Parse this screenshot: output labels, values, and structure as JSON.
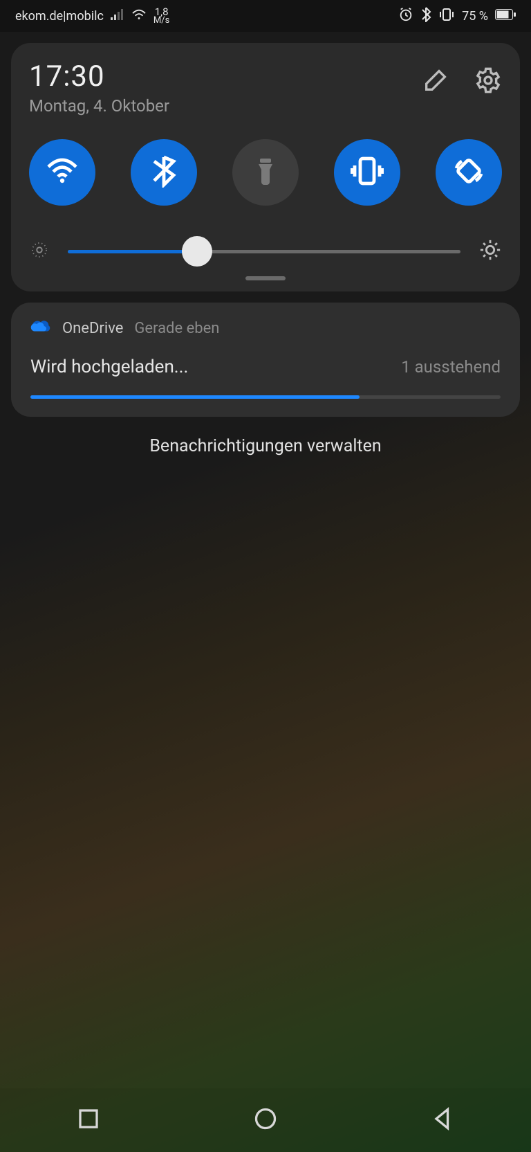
{
  "statusbar": {
    "carrier": "ekom.de|mobilc",
    "speed_value": "1,8",
    "speed_unit": "M/s",
    "battery_pct": "75 %"
  },
  "qs": {
    "time": "17:30",
    "date": "Montag, 4. Oktober",
    "toggles": {
      "wifi": true,
      "bluetooth": true,
      "flashlight": false,
      "vibrate": true,
      "autorotate": true
    },
    "brightness_pct": 33
  },
  "notification": {
    "app": "OneDrive",
    "when": "Gerade eben",
    "title": "Wird hochgeladen...",
    "subtitle": "1 ausstehend",
    "progress_pct": 70
  },
  "manage_label": "Benachrichtigungen verwalten",
  "colors": {
    "accent": "#0f6dd8",
    "panel": "#2b2b2b"
  }
}
